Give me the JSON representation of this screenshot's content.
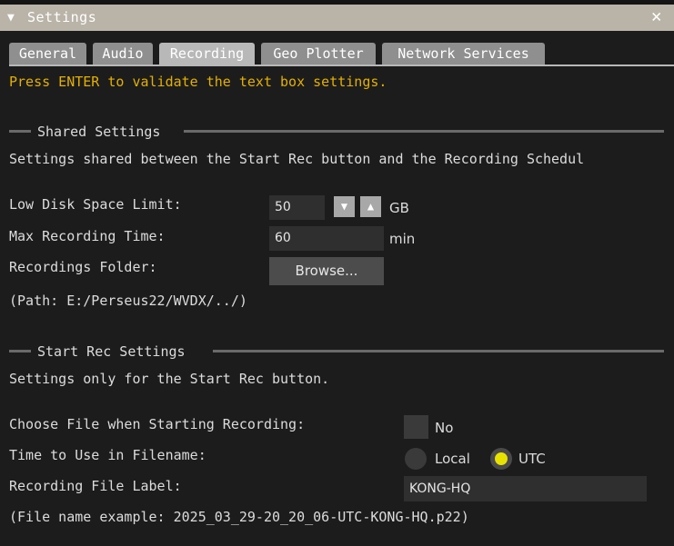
{
  "window": {
    "title": "Settings",
    "collapse_glyph": "▼",
    "close_glyph": "✕"
  },
  "tabs": [
    {
      "label": "General"
    },
    {
      "label": "Audio"
    },
    {
      "label": "Recording",
      "active": true
    },
    {
      "label": "Geo Plotter"
    },
    {
      "label": "Network Services"
    }
  ],
  "hint": "Press ENTER to validate the text box settings.",
  "shared": {
    "heading": "Shared Settings",
    "description": "Settings shared between the Start Rec button and the Recording Schedul",
    "low_disk_label": "Low Disk Space Limit:",
    "low_disk_value": "50",
    "low_disk_unit": "GB",
    "max_time_label": "Max Recording Time:",
    "max_time_value": "60",
    "max_time_unit": "min",
    "folder_label": "Recordings Folder:",
    "browse_label": "Browse...",
    "path_text": "(Path: E:/Perseus22/WVDX/../)"
  },
  "start_rec": {
    "heading": "Start Rec Settings",
    "description": "Settings only for the Start Rec button.",
    "choose_file_label": "Choose File when Starting Recording:",
    "choose_file_value": "No",
    "time_label": "Time to Use in Filename:",
    "time_options": [
      "Local",
      "UTC"
    ],
    "time_selected": "UTC",
    "file_label_label": "Recording File Label:",
    "file_label_value": "KONG-HQ",
    "example_text": "(File name example: 2025_03_29-20_20_06-UTC-KONG-HQ.p22)"
  },
  "colors": {
    "hint": "#e4b000",
    "titlebar": "#bab4a8",
    "active_tab": "#b8b8b8",
    "radio_selected": "#e8e200"
  }
}
